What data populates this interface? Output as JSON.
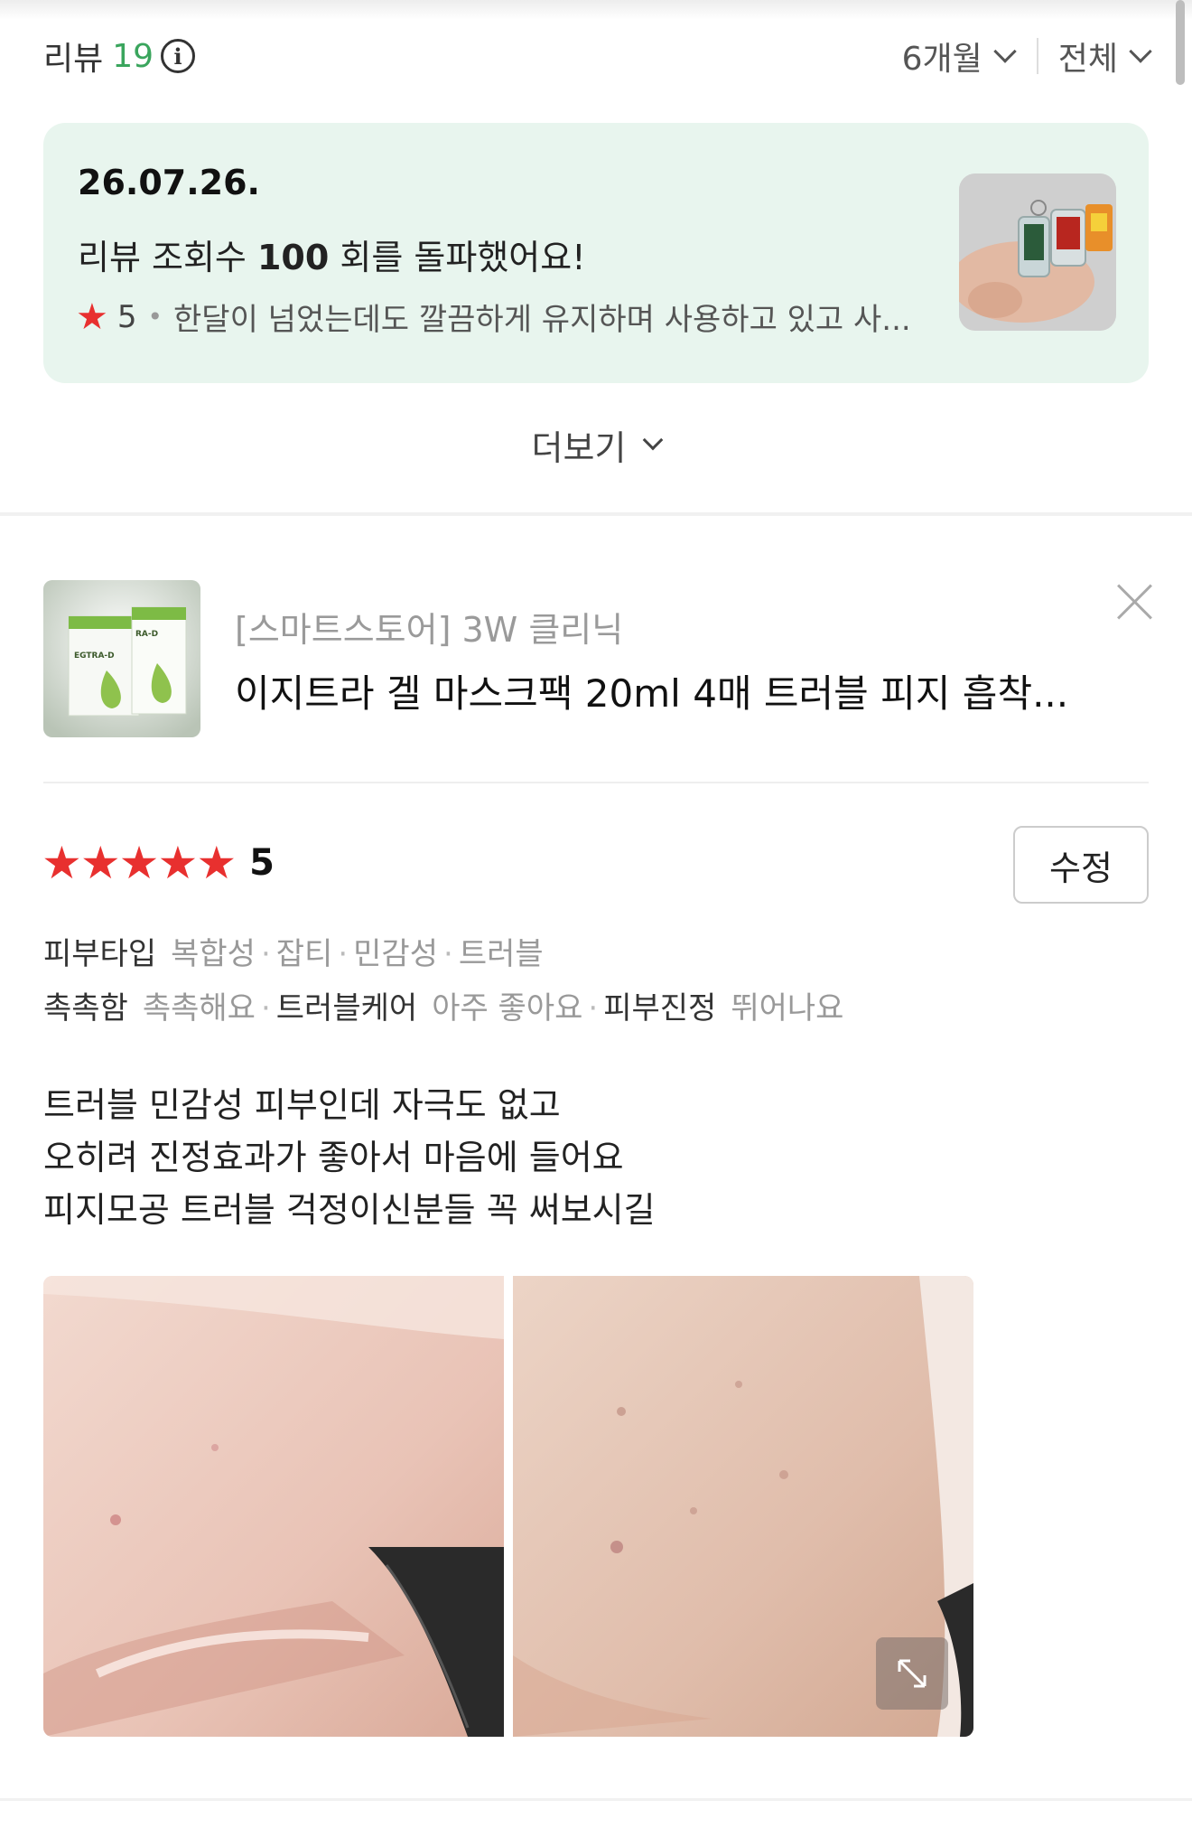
{
  "header": {
    "title": "리뷰",
    "count": "19",
    "info_glyph": "i",
    "period_filter": "6개월",
    "type_filter": "전체"
  },
  "highlight": {
    "date": "26.07.26.",
    "message_prefix": "리뷰 조회수",
    "message_number": "100",
    "message_suffix": "회를 돌파했어요!",
    "star_glyph": "★",
    "score": "5",
    "review_snippet": "한달이 넘었는데도 깔끔하게 유지하며 사용하고 있고 사..."
  },
  "more_label": "더보기",
  "product": {
    "store": "[스마트스토어] 3W 클리닉",
    "name": "이지트라 겔 마스크팩 20ml 4매 트러블 피지 흡착...",
    "package_text_1": "EGTRA-D",
    "package_text_2": "RA-D"
  },
  "review": {
    "stars": [
      "★",
      "★",
      "★",
      "★",
      "★"
    ],
    "rating": "5",
    "edit_label": "수정",
    "skin_type_label": "피부타입",
    "skin_types": [
      "복합성",
      "잡티",
      "민감성",
      "트러블"
    ],
    "evaluations": [
      {
        "key": "촉촉함",
        "value": "촉촉해요"
      },
      {
        "key": "트러블케어",
        "value": "아주 좋아요"
      },
      {
        "key": "피부진정",
        "value": "뛰어나요"
      }
    ],
    "body_lines": [
      "트러블 민감성 피부인데 자극도 없고",
      "오히려 진정효과가 좋아서 마음에 들어요",
      "피지모공 트러블 걱정이신분들 꼭 써보시길"
    ]
  },
  "colors": {
    "accent_green": "#3aa55d",
    "highlight_bg": "#e8f5ee",
    "star_red": "#e8302f"
  },
  "icons": {
    "info": "info-circle-icon",
    "chevron": "chevron-down-icon",
    "close": "close-icon",
    "expand": "expand-icon",
    "star": "star-icon"
  }
}
